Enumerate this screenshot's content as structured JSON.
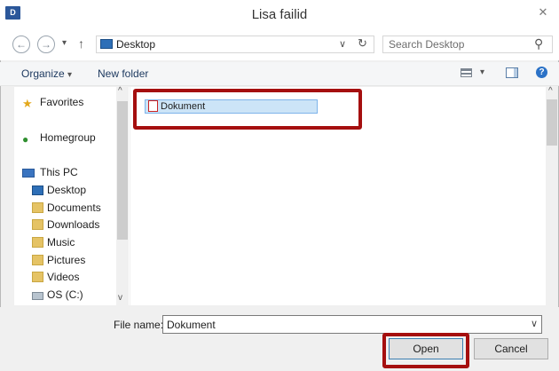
{
  "window": {
    "title": "Lisa failid",
    "app_icon_text": "D",
    "close_glyph": "✕"
  },
  "nav": {
    "back_glyph": "←",
    "forward_glyph": "→",
    "dropdown_glyph": "▾",
    "up_glyph": "↑",
    "address": "Desktop",
    "address_dropdown_glyph": "∨",
    "refresh_glyph": "↻",
    "search_placeholder": "Search Desktop",
    "search_glyph": "⚲"
  },
  "toolbar": {
    "organize_label": "Organize",
    "organize_caret": "▾",
    "new_folder_label": "New folder",
    "view_caret": "▾",
    "help_glyph": "?"
  },
  "sidebar": {
    "favorites": "Favorites",
    "homegroup": "Homegroup",
    "this_pc": "This PC",
    "items": [
      {
        "label": "Desktop"
      },
      {
        "label": "Documents"
      },
      {
        "label": "Downloads"
      },
      {
        "label": "Music"
      },
      {
        "label": "Pictures"
      },
      {
        "label": "Videos"
      },
      {
        "label": "OS (C:)"
      }
    ],
    "scroll_up": "^",
    "scroll_down": "v"
  },
  "content": {
    "files": [
      {
        "name": "Dokument",
        "type": "pdf"
      }
    ],
    "scroll_up": "^"
  },
  "footer": {
    "file_name_label": "File name:",
    "file_name_value": "Dokument",
    "dropdown_glyph": "∨",
    "open_label": "Open",
    "cancel_label": "Cancel"
  },
  "colors": {
    "highlight": "#a50f0f",
    "selection": "#cce4f7",
    "accent": "#2b579a"
  }
}
